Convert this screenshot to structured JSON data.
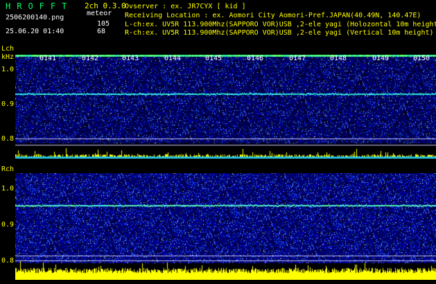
{
  "header": {
    "title": "HROFFT",
    "version": "2ch 0.3.0",
    "filename": "2506200140.png",
    "meteor_label": "meteor",
    "l_count": "105",
    "r_count": "68",
    "datetime": "25.06.20 01:40",
    "observer": "Ovserver           : ex. JR7CYX [ kid ]",
    "location": "Receiving Location : ex. Aomori City Aomori-Pref.JAPAN(40.49N, 140.47E)",
    "l_channel": "L-ch:ex. UV5R 113.900Mhz(SAPPORO VOR)USB ,2-ele yagi (Holozontal 10m height)",
    "r_channel": "R-ch:ex. UV5R 113.900Mhz(SAPPORO VOR)USB ,2-ele yagi (Vertical 10m height)"
  },
  "time_labels": [
    "0141",
    "0142",
    "0143",
    "0144",
    "0145",
    "0146",
    "0147",
    "0148",
    "0149",
    "0150"
  ],
  "lch": {
    "label": "Lch",
    "unit": "kHz",
    "ticks": [
      "1.0",
      "0.9",
      "0.8"
    ]
  },
  "rch": {
    "label": "Rch",
    "ticks": [
      "1.0",
      "0.9",
      "0.8"
    ]
  },
  "colors": {
    "background": "#000000",
    "header_text": "#ffff00",
    "title": "#00ff66",
    "noise_dark": "#000060",
    "noise_mid": "#0000c8",
    "signal": "#40ffff",
    "amplitude": "#ffff00"
  }
}
